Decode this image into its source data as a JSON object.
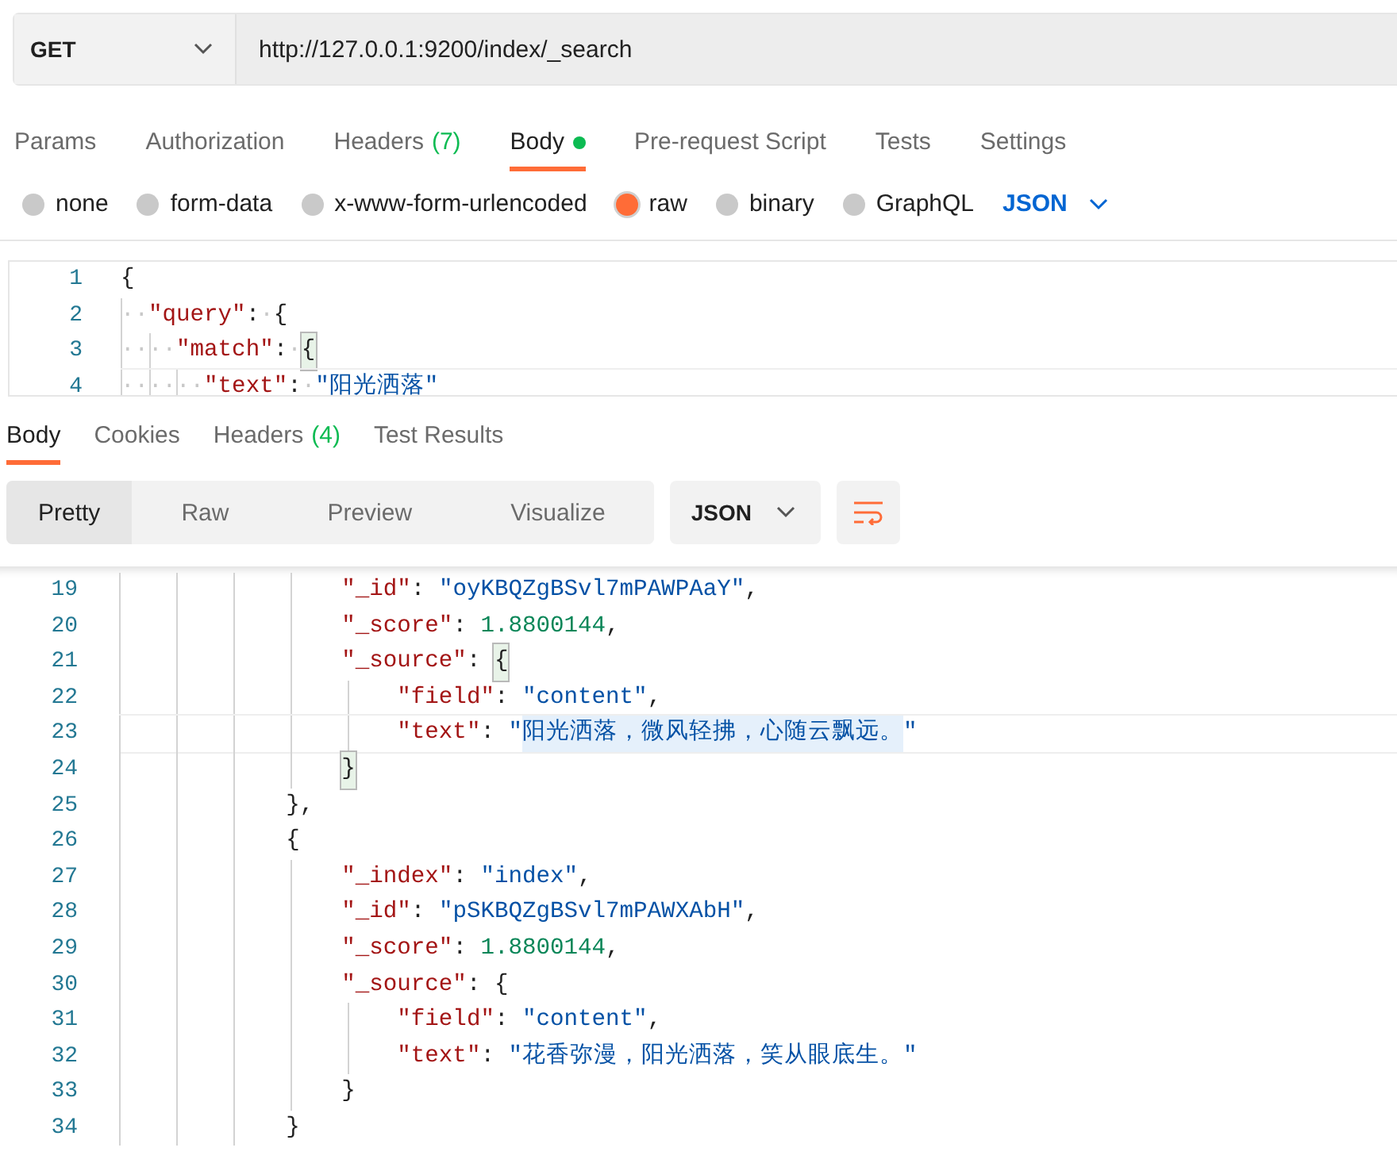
{
  "request": {
    "method": "GET",
    "url": "http://127.0.0.1:9200/index/_search"
  },
  "request_tabs": [
    {
      "label": "Params",
      "selected": false
    },
    {
      "label": "Authorization",
      "selected": false
    },
    {
      "label": "Headers",
      "count": "(7)",
      "selected": false
    },
    {
      "label": "Body",
      "modified": true,
      "selected": true
    },
    {
      "label": "Pre-request Script",
      "selected": false
    },
    {
      "label": "Tests",
      "selected": false
    },
    {
      "label": "Settings",
      "selected": false
    }
  ],
  "body_types": [
    {
      "label": "none",
      "selected": false
    },
    {
      "label": "form-data",
      "selected": false
    },
    {
      "label": "x-www-form-urlencoded",
      "selected": false
    },
    {
      "label": "raw",
      "selected": true
    },
    {
      "label": "binary",
      "selected": false
    },
    {
      "label": "GraphQL",
      "selected": false
    }
  ],
  "body_format": "JSON",
  "request_editor": {
    "lines": [
      {
        "number": "1",
        "tokens": [
          {
            "kind": "punct",
            "text": "{"
          }
        ]
      },
      {
        "number": "2",
        "tokens": [
          {
            "kind": "whitespace",
            "text": "··"
          },
          {
            "kind": "key",
            "text": "\"query\""
          },
          {
            "kind": "punct",
            "text": ":"
          },
          {
            "kind": "whitespace",
            "text": "·"
          },
          {
            "kind": "punct",
            "text": "{"
          }
        ]
      },
      {
        "number": "3",
        "tokens": [
          {
            "kind": "whitespace",
            "text": "····"
          },
          {
            "kind": "key",
            "text": "\"match\""
          },
          {
            "kind": "punct",
            "text": ":"
          },
          {
            "kind": "whitespace",
            "text": "·"
          },
          {
            "kind": "punct",
            "text": "{",
            "matched": true
          }
        ]
      },
      {
        "number": "4",
        "highlighted": true,
        "tokens": [
          {
            "kind": "whitespace",
            "text": "······"
          },
          {
            "kind": "key",
            "text": "\"text\""
          },
          {
            "kind": "punct",
            "text": ":"
          },
          {
            "kind": "whitespace",
            "text": "·"
          },
          {
            "kind": "string",
            "text": "\"阳光洒落\""
          }
        ]
      }
    ]
  },
  "response_tabs": [
    {
      "label": "Body",
      "selected": true
    },
    {
      "label": "Cookies",
      "selected": false
    },
    {
      "label": "Headers",
      "count": "(4)",
      "selected": false
    },
    {
      "label": "Test Results",
      "selected": false
    }
  ],
  "view_modes": [
    {
      "label": "Pretty",
      "selected": true
    },
    {
      "label": "Raw",
      "selected": false
    },
    {
      "label": "Preview",
      "selected": false
    },
    {
      "label": "Visualize",
      "selected": false
    }
  ],
  "response_format": "JSON",
  "wrap_lines": true,
  "response_editor": {
    "lines": [
      {
        "number": "19",
        "tokens": [
          {
            "kind": "key",
            "text": "                \"_id\""
          },
          {
            "kind": "punct",
            "text": ": "
          },
          {
            "kind": "string",
            "text": "\"oyKBQZgBSvl7mPAWPAaY\""
          },
          {
            "kind": "punct",
            "text": ","
          }
        ]
      },
      {
        "number": "20",
        "tokens": [
          {
            "kind": "key",
            "text": "                \"_score\""
          },
          {
            "kind": "punct",
            "text": ": "
          },
          {
            "kind": "number",
            "text": "1.8800144"
          },
          {
            "kind": "punct",
            "text": ","
          }
        ]
      },
      {
        "number": "21",
        "tokens": [
          {
            "kind": "key",
            "text": "                \"_source\""
          },
          {
            "kind": "punct",
            "text": ": "
          },
          {
            "kind": "punct",
            "text": "{",
            "matched": true
          }
        ]
      },
      {
        "number": "22",
        "tokens": [
          {
            "kind": "key",
            "text": "                    \"field\""
          },
          {
            "kind": "punct",
            "text": ": "
          },
          {
            "kind": "string",
            "text": "\"content\""
          },
          {
            "kind": "punct",
            "text": ","
          }
        ]
      },
      {
        "number": "23",
        "highlighted": true,
        "tokens": [
          {
            "kind": "key",
            "text": "                    \"text\""
          },
          {
            "kind": "punct",
            "text": ": "
          },
          {
            "kind": "string",
            "text": "\""
          },
          {
            "kind": "string",
            "text": "阳光洒落，微风轻拂，心随云飘远。",
            "selected": true
          },
          {
            "kind": "string",
            "text": "\""
          }
        ]
      },
      {
        "number": "24",
        "tokens": [
          {
            "kind": "punct",
            "text": "                }",
            "matched": true
          }
        ]
      },
      {
        "number": "25",
        "tokens": [
          {
            "kind": "punct",
            "text": "            },"
          }
        ]
      },
      {
        "number": "26",
        "tokens": [
          {
            "kind": "punct",
            "text": "            {"
          }
        ]
      },
      {
        "number": "27",
        "tokens": [
          {
            "kind": "key",
            "text": "                \"_index\""
          },
          {
            "kind": "punct",
            "text": ": "
          },
          {
            "kind": "string",
            "text": "\"index\""
          },
          {
            "kind": "punct",
            "text": ","
          }
        ]
      },
      {
        "number": "28",
        "tokens": [
          {
            "kind": "key",
            "text": "                \"_id\""
          },
          {
            "kind": "punct",
            "text": ": "
          },
          {
            "kind": "string",
            "text": "\"pSKBQZgBSvl7mPAWXAbH\""
          },
          {
            "kind": "punct",
            "text": ","
          }
        ]
      },
      {
        "number": "29",
        "tokens": [
          {
            "kind": "key",
            "text": "                \"_score\""
          },
          {
            "kind": "punct",
            "text": ": "
          },
          {
            "kind": "number",
            "text": "1.8800144"
          },
          {
            "kind": "punct",
            "text": ","
          }
        ]
      },
      {
        "number": "30",
        "tokens": [
          {
            "kind": "key",
            "text": "                \"_source\""
          },
          {
            "kind": "punct",
            "text": ": {"
          }
        ]
      },
      {
        "number": "31",
        "tokens": [
          {
            "kind": "key",
            "text": "                    \"field\""
          },
          {
            "kind": "punct",
            "text": ": "
          },
          {
            "kind": "string",
            "text": "\"content\""
          },
          {
            "kind": "punct",
            "text": ","
          }
        ]
      },
      {
        "number": "32",
        "tokens": [
          {
            "kind": "key",
            "text": "                    \"text\""
          },
          {
            "kind": "punct",
            "text": ": "
          },
          {
            "kind": "string",
            "text": "\"花香弥漫，阳光洒落，笑从眼底生。\""
          }
        ]
      },
      {
        "number": "33",
        "tokens": [
          {
            "kind": "punct",
            "text": "                }"
          }
        ]
      },
      {
        "number": "34",
        "tokens": [
          {
            "kind": "punct",
            "text": "            }"
          }
        ]
      }
    ]
  }
}
